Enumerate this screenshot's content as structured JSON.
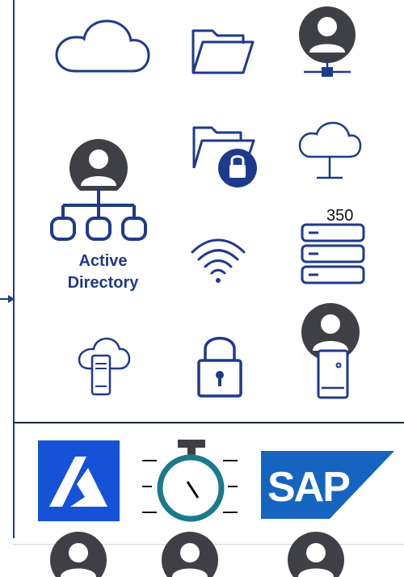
{
  "labels": {
    "active_directory_line1": "Active",
    "active_directory_line2": "Directory",
    "server_count": "350"
  },
  "icons": [
    "cloud-icon",
    "folder-icon",
    "user-network-icon",
    "user-icon",
    "org-chart-icon",
    "locked-folder-icon",
    "cloud-network-icon",
    "wifi-icon",
    "server-stack-icon",
    "cloud-computer-icon",
    "padlock-icon",
    "user-device-icon",
    "azure-logo",
    "stopwatch-icon",
    "sap-logo"
  ],
  "logos": {
    "sap_text": "SAP",
    "registered_mark": "®"
  },
  "colors": {
    "navy": "#1e3a8a",
    "avatar": "#3f3f46",
    "azure": "#1652d8",
    "sap": "#1565c0",
    "stopwatch_ring": "#1b7a8c",
    "connector": "#1f3a8a"
  }
}
